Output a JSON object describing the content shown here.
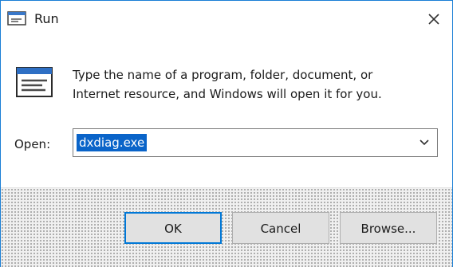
{
  "window": {
    "title": "Run",
    "icons": {
      "title": "run-app-icon",
      "close": "close-icon",
      "main": "run-icon",
      "dropdown": "chevron-down-icon"
    }
  },
  "description": "Type the name of a program, folder, document, or Internet resource, and Windows will open it for you.",
  "open_field": {
    "label": "Open:",
    "value": "dxdiag.exe"
  },
  "buttons": {
    "ok": "OK",
    "cancel": "Cancel",
    "browse": "Browse..."
  },
  "colors": {
    "accent": "#0078d7",
    "selection": "#0a64c9",
    "footer_bg": "#f0f0f0"
  }
}
